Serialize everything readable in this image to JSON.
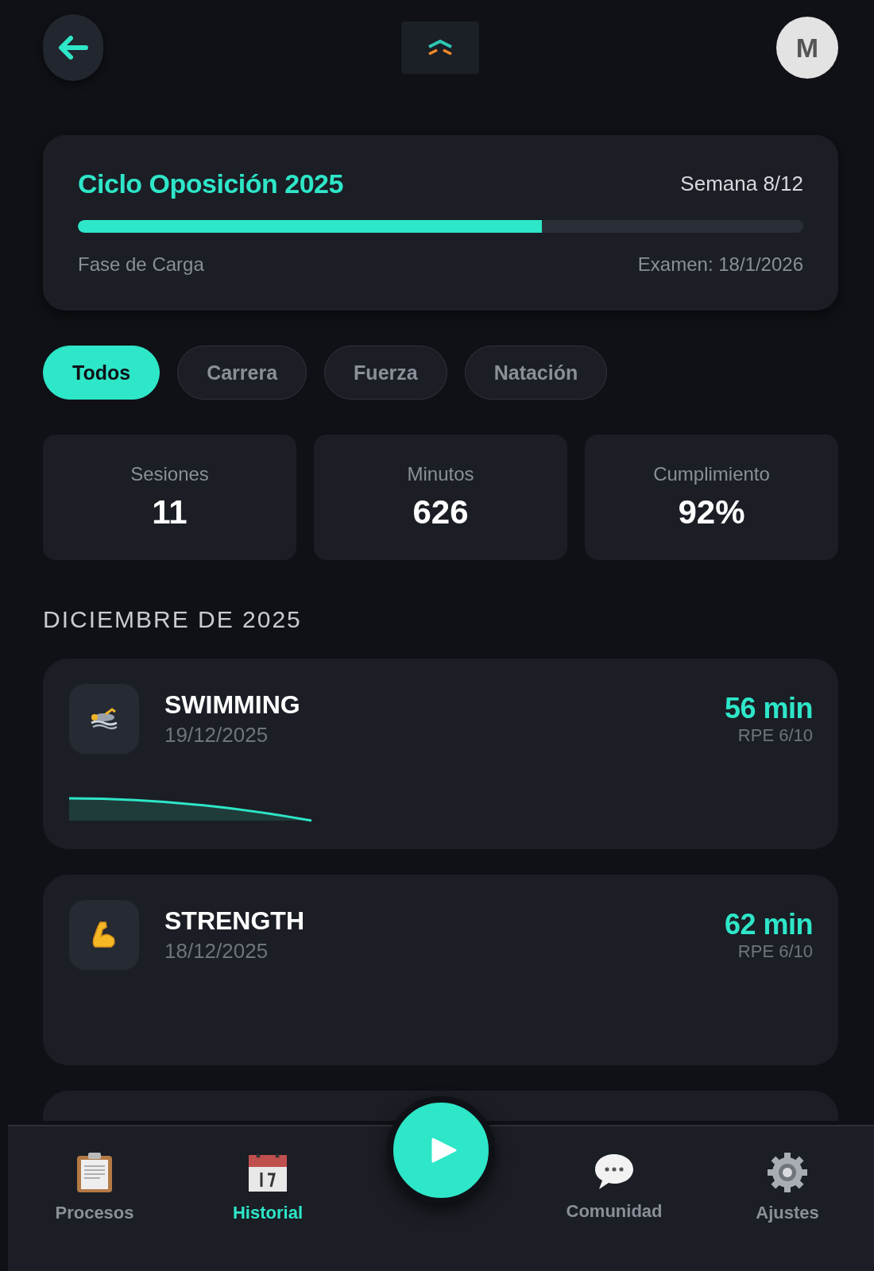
{
  "header": {
    "avatar": "M"
  },
  "cycle": {
    "title": "Ciclo Oposición 2025",
    "week": "Semana 8/12",
    "level": 0.64,
    "phase": "Fase de Carga",
    "exam": "Examen: 18/1/2026"
  },
  "filters": [
    {
      "label": "Todos",
      "selected": true
    },
    {
      "label": "Carrera",
      "selected": false
    },
    {
      "label": "Fuerza",
      "selected": false
    },
    {
      "label": "Natación",
      "selected": false
    }
  ],
  "stats": [
    {
      "label": "Sesiones",
      "value": "11"
    },
    {
      "label": "Minutos",
      "value": "626"
    },
    {
      "label": "Cumplimiento",
      "value": "92%"
    }
  ],
  "section_title": "DICIEMBRE DE 2025",
  "sessions": [
    {
      "kind": "swimming",
      "title": "SWIMMING",
      "date": "19/12/2025",
      "duration": "56 min",
      "rpe": "RPE 6/10"
    },
    {
      "kind": "strength",
      "title": "STRENGTH",
      "date": "18/12/2025",
      "duration": "62 min",
      "rpe": "RPE 6/10"
    }
  ],
  "nav": [
    {
      "kind": "clipboard",
      "label": "Procesos",
      "selected": false
    },
    {
      "kind": "calendar",
      "label": "Historial",
      "selected": true
    },
    {
      "kind": "play"
    },
    {
      "kind": "chat",
      "label": "Comunidad",
      "selected": false
    },
    {
      "kind": "gear",
      "label": "Ajustes",
      "selected": false
    }
  ]
}
